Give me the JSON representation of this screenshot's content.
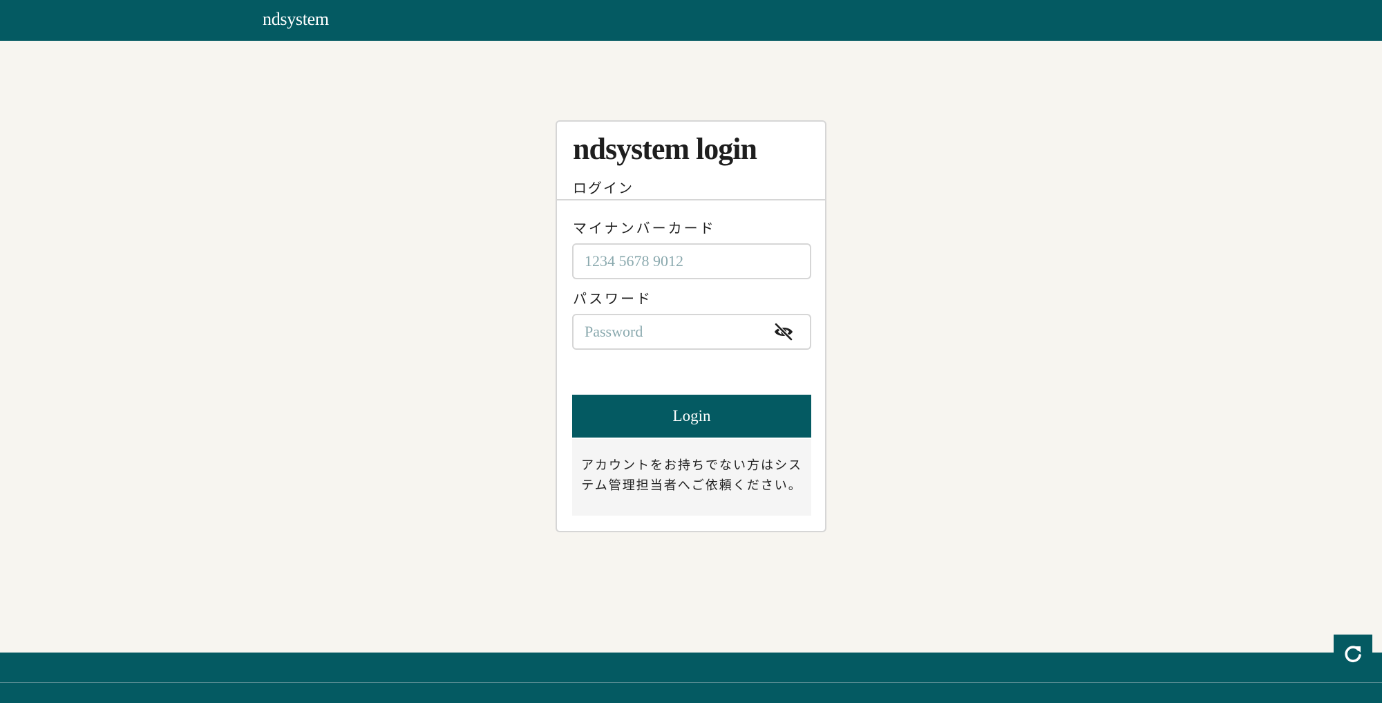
{
  "header": {
    "brand": "ndsystem"
  },
  "login_card": {
    "title": "ndsystem login",
    "subtitle": "ログイン",
    "card_field": {
      "label": "マイナンバーカード",
      "placeholder": "1234 5678 9012",
      "value": ""
    },
    "password_field": {
      "label": "パスワード",
      "placeholder": "Password",
      "value": ""
    },
    "submit_label": "Login",
    "note": "アカウントをお持ちでない方はシステム管理担当者へご依頼ください。"
  },
  "icons": {
    "password_toggle": "eye-slash-icon",
    "refresh": "refresh-icon"
  },
  "colors": {
    "brand": "#045a62",
    "background": "#f7f5f0",
    "card": "#ffffff",
    "placeholder": "#8aa9ae"
  }
}
